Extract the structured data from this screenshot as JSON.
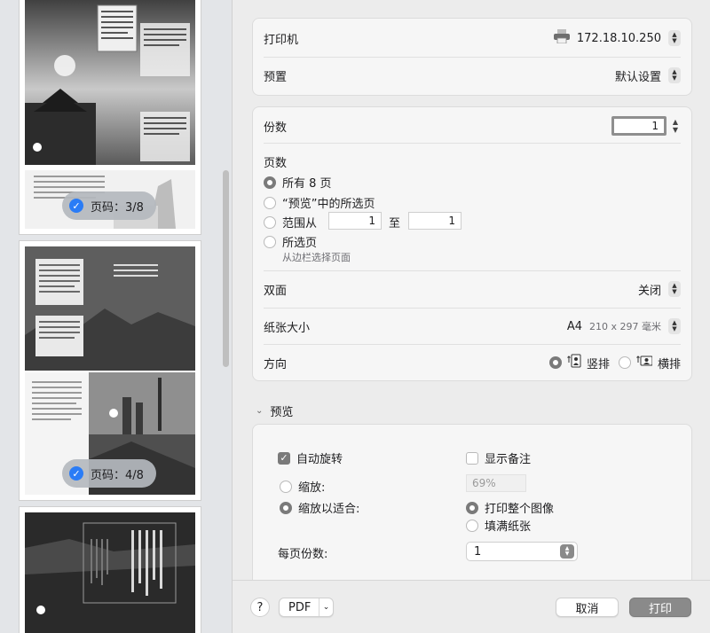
{
  "sidebar": {
    "badges": [
      {
        "label": "页码：3/8"
      },
      {
        "label": "页码：4/8"
      }
    ]
  },
  "printer": {
    "label": "打印机",
    "value": "172.18.10.250"
  },
  "presets": {
    "label": "预置",
    "value": "默认设置"
  },
  "copies": {
    "label": "份数",
    "value": "1"
  },
  "pages": {
    "label": "页数",
    "options": {
      "all": "所有 8 页",
      "preview_selection": "“预览”中的所选页",
      "range": "范围从",
      "range_to": "至",
      "selected": "所选页",
      "selected_note": "从边栏选择页面"
    },
    "range_from": "1",
    "range_to_value": "1"
  },
  "duplex": {
    "label": "双面",
    "value": "关闭"
  },
  "paper_size": {
    "label": "纸张大小",
    "value": "A4",
    "detail": "210 x 297 毫米"
  },
  "orientation": {
    "label": "方向",
    "portrait": "竖排",
    "landscape": "横排"
  },
  "preview_section": {
    "title": "预览",
    "auto_rotate": "自动旋转",
    "show_notes": "显示备注",
    "scale": "缩放:",
    "scale_value": "69%",
    "scale_to_fit": "缩放以适合:",
    "print_entire": "打印整个图像",
    "fill_paper": "填满纸张",
    "copies_per_page": "每页份数:",
    "copies_per_page_value": "1"
  },
  "bottom": {
    "help": "?",
    "pdf": "PDF",
    "cancel": "取消",
    "print": "打印"
  },
  "colors": {
    "accent": "#2a7cf6",
    "primary_button": "#8a8a8a"
  }
}
